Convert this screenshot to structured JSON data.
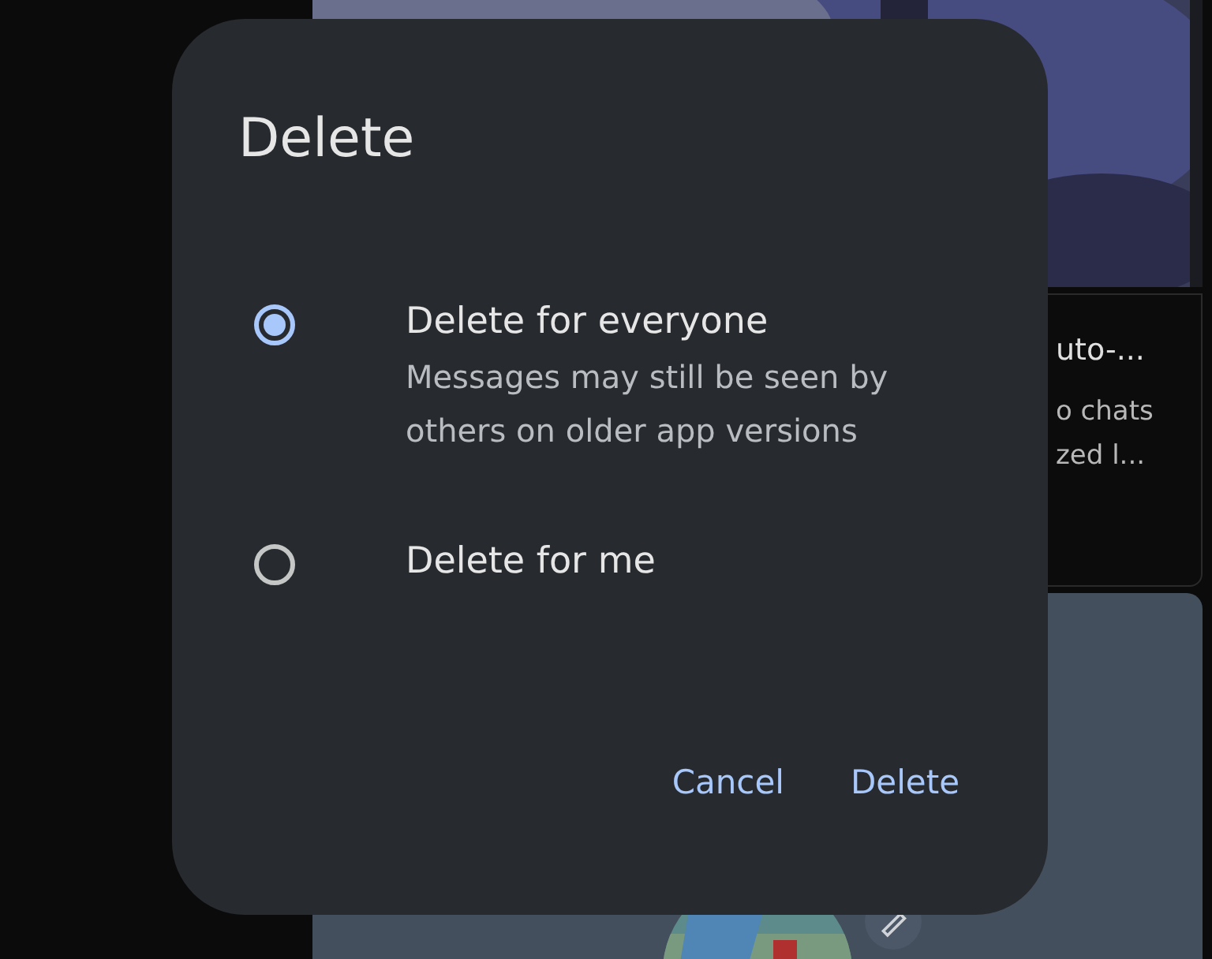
{
  "background_card": {
    "title": "uto-...",
    "lines": [
      "o chats",
      "zed l..."
    ]
  },
  "dialog": {
    "title": "Delete",
    "options": [
      {
        "label": "Delete for everyone",
        "description": "Messages may still be seen by others on older app versions",
        "selected": true
      },
      {
        "label": "Delete for me",
        "selected": false
      }
    ],
    "buttons": [
      "Cancel",
      "Delete"
    ]
  }
}
